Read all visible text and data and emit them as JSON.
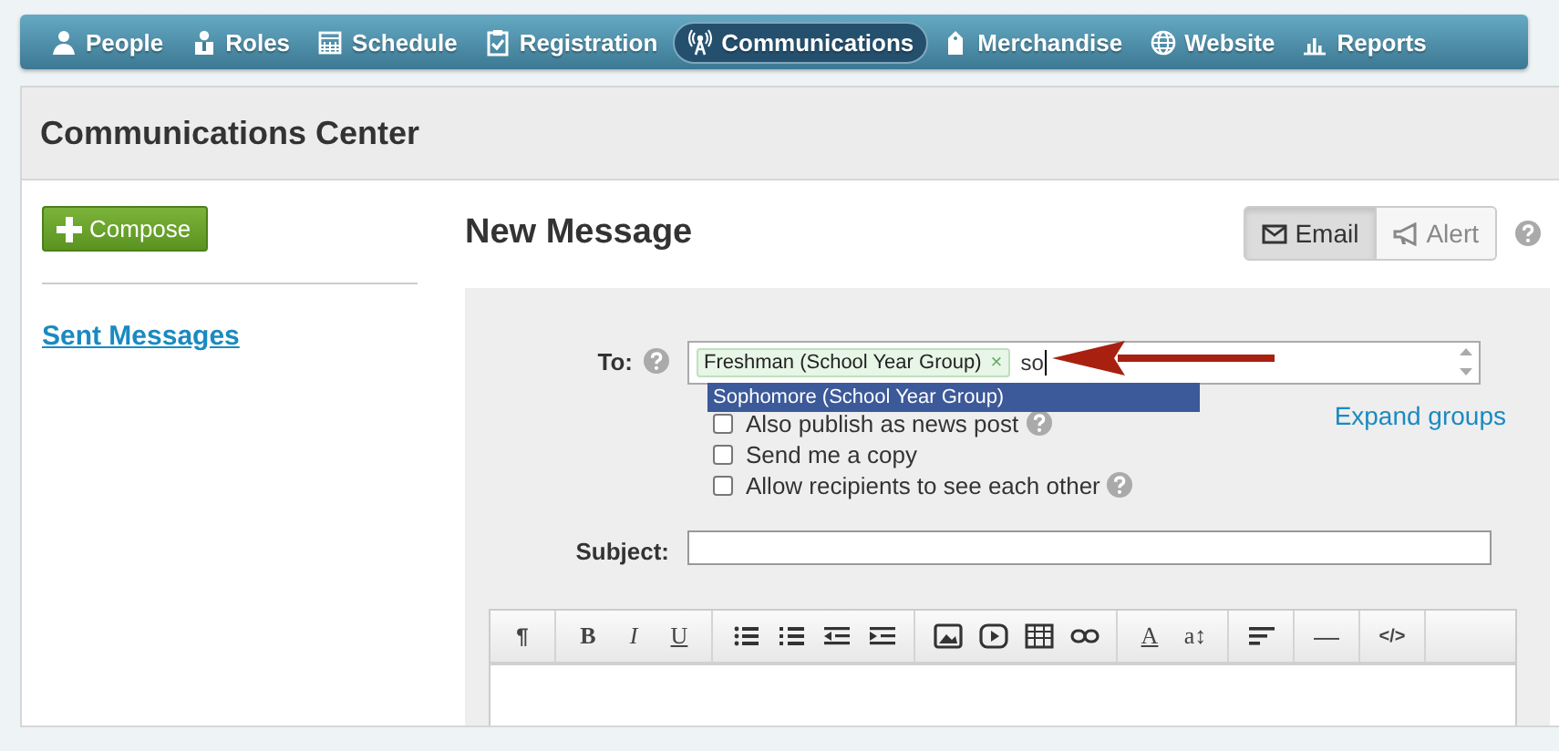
{
  "nav": [
    {
      "label": "People",
      "kind": "person",
      "selected": false
    },
    {
      "label": "Roles",
      "kind": "roles",
      "selected": false
    },
    {
      "label": "Schedule",
      "kind": "calendar",
      "selected": false
    },
    {
      "label": "Registration",
      "kind": "clipboard",
      "selected": false
    },
    {
      "label": "Communications",
      "kind": "antenna",
      "selected": true
    },
    {
      "label": "Merchandise",
      "kind": "tag",
      "selected": false
    },
    {
      "label": "Website",
      "kind": "globe",
      "selected": false
    },
    {
      "label": "Reports",
      "kind": "chart",
      "selected": false
    }
  ],
  "page_title": "Communications Center",
  "compose_button": "Compose",
  "sidebar_links": [
    "Sent Messages"
  ],
  "heading": "New Message",
  "mode_buttons": [
    {
      "label": "Email",
      "kind": "email",
      "selected": true
    },
    {
      "label": "Alert",
      "kind": "alert",
      "selected": false
    }
  ],
  "to": {
    "label": "To:",
    "tokens": [
      {
        "label": "Freshman (School Year Group)",
        "remove": "×"
      }
    ],
    "value": "so",
    "suggestions": [
      {
        "label": "Sophomore (School Year Group)",
        "selected": true
      }
    ],
    "expand_link": "Expand groups"
  },
  "options": [
    {
      "label": "Also publish as news post",
      "checked": false,
      "help": true
    },
    {
      "label": "Send me a copy",
      "checked": false,
      "help": false
    },
    {
      "label": "Allow recipients to see each other",
      "checked": false,
      "help": true
    }
  ],
  "subject": {
    "label": "Subject:"
  },
  "toolbar": [
    [
      {
        "kind": "paragraph",
        "label": "¶"
      }
    ],
    [
      {
        "kind": "bold",
        "label": "B"
      },
      {
        "kind": "italic",
        "label": "I"
      },
      {
        "kind": "underline",
        "label": "U"
      }
    ],
    [
      {
        "kind": "bullets"
      },
      {
        "kind": "numbers"
      },
      {
        "kind": "outdent"
      },
      {
        "kind": "indent"
      }
    ],
    [
      {
        "kind": "image"
      },
      {
        "kind": "video"
      },
      {
        "kind": "table"
      },
      {
        "kind": "link"
      }
    ],
    [
      {
        "kind": "color",
        "label": "A"
      },
      {
        "kind": "size",
        "label": "a↕"
      }
    ],
    [
      {
        "kind": "align"
      }
    ],
    [
      {
        "kind": "rule",
        "label": "—"
      }
    ],
    [
      {
        "kind": "code",
        "label": "</>"
      }
    ]
  ]
}
